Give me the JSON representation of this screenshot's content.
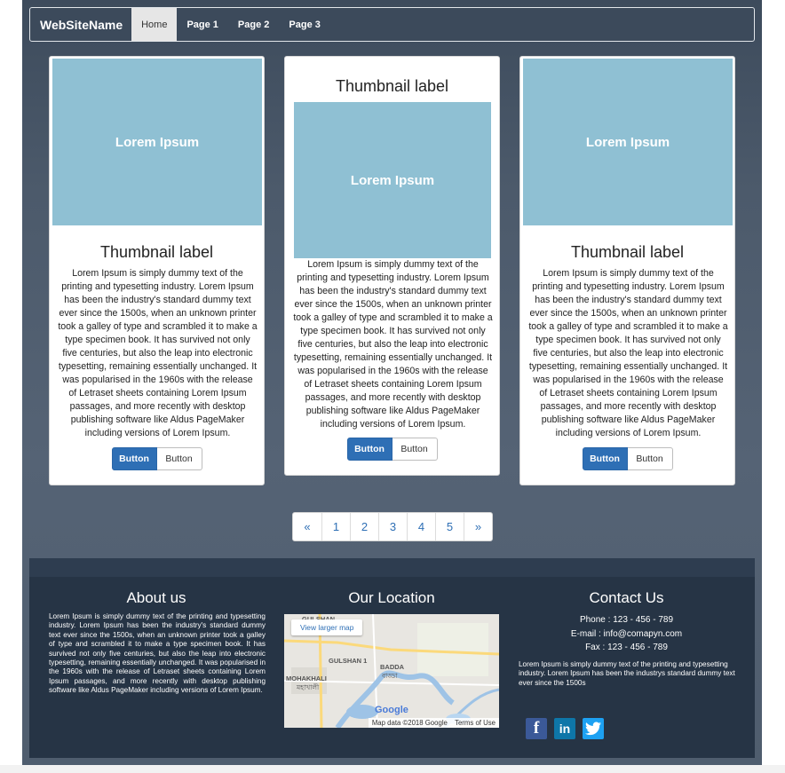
{
  "navbar": {
    "brand": "WebSiteName",
    "items": [
      {
        "label": "Home"
      },
      {
        "label": "Page 1"
      },
      {
        "label": "Page 2"
      },
      {
        "label": "Page 3"
      }
    ]
  },
  "cards": [
    {
      "image_text": "Lorem Ipsum",
      "title": "Thumbnail label",
      "text": "Lorem Ipsum is simply dummy text of the printing and typesetting industry. Lorem Ipsum has been the industry's standard dummy text ever since the 1500s, when an unknown printer took a galley of type and scrambled it to make a type specimen book. It has survived not only five centuries, but also the leap into electronic typesetting, remaining essentially unchanged. It was popularised in the 1960s with the release of Letraset sheets containing Lorem Ipsum passages, and more recently with desktop publishing software like Aldus PageMaker including versions of Lorem Ipsum.",
      "primary_label": "Button",
      "default_label": "Button"
    },
    {
      "image_text": "Lorem Ipsum",
      "title": "Thumbnail label",
      "text": "Lorem Ipsum is simply dummy text of the printing and typesetting industry. Lorem Ipsum has been the industry's standard dummy text ever since the 1500s, when an unknown printer took a galley of type and scrambled it to make a type specimen book. It has survived not only five centuries, but also the leap into electronic typesetting, remaining essentially unchanged. It was popularised in the 1960s with the release of Letraset sheets containing Lorem Ipsum passages, and more recently with desktop publishing software like Aldus PageMaker including versions of Lorem Ipsum.",
      "primary_label": "Button",
      "default_label": "Button"
    },
    {
      "image_text": "Lorem Ipsum",
      "title": "Thumbnail label",
      "text": "Lorem Ipsum is simply dummy text of the printing and typesetting industry. Lorem Ipsum has been the industry's standard dummy text ever since the 1500s, when an unknown printer took a galley of type and scrambled it to make a type specimen book. It has survived not only five centuries, but also the leap into electronic typesetting, remaining essentially unchanged. It was popularised in the 1960s with the release of Letraset sheets containing Lorem Ipsum passages, and more recently with desktop publishing software like Aldus PageMaker including versions of Lorem Ipsum.",
      "primary_label": "Button",
      "default_label": "Button"
    }
  ],
  "pagination": [
    "«",
    "1",
    "2",
    "3",
    "4",
    "5",
    "»"
  ],
  "footer": {
    "about": {
      "title": "About us",
      "text": "Lorem Ipsum is simply dummy text of the printing and typesetting industry. Lorem Ipsum has been the industry's standard dummy text ever since the 1500s, when an unknown printer took a galley of type and scrambled it to make a type specimen book. It has survived not only five centuries, but also the leap into electronic typesetting, remaining essentially unchanged. It was popularised in the 1960s with the release of Letraset sheets containing Lorem Ipsum passages, and more recently with desktop publishing software like Aldus PageMaker including versions of Lorem Ipsum."
    },
    "location": {
      "title": "Our Location",
      "view_larger": "View larger map",
      "labels": [
        "GULSHAN",
        "GULSHAN 1",
        "BADDA",
        "MOHAKHALI",
        "মহাখালী",
        "বাড্ডা"
      ],
      "google": "Google",
      "map_data": "Map data ©2018 Google",
      "terms": "Terms of Use"
    },
    "contact": {
      "title": "Contact Us",
      "phone": "Phone : 123 - 456 - 789",
      "email": "E-mail : info@comapyn.com",
      "fax": "Fax : 123 - 456 - 789",
      "text": "Lorem Ipsum is simply dummy text of the printing and typesetting industry. Lorem Ipsum has been the industrys standard dummy text ever since the 1500s",
      "social": [
        "facebook-icon",
        "linkedin-icon",
        "twitter-icon"
      ]
    }
  }
}
